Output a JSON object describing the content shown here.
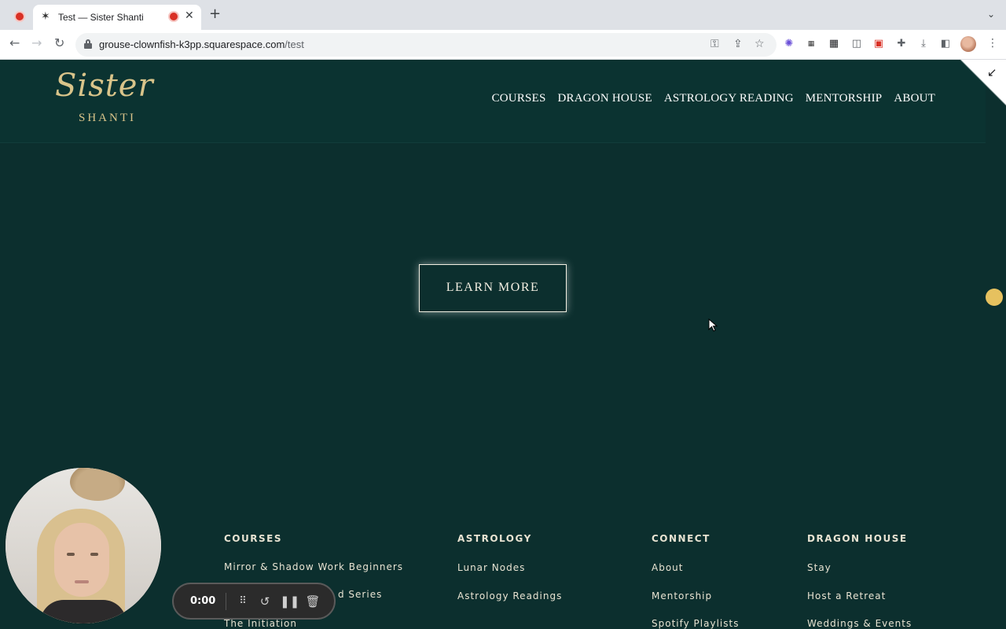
{
  "browser": {
    "tab_title": "Test — Sister Shanti",
    "url_host": "grouse-clownfish-k3pp.squarespace.com",
    "url_path": "/test"
  },
  "site": {
    "logo_script": "Sister",
    "logo_sub": "SHANTI",
    "nav": [
      "COURSES",
      "DRAGON HOUSE",
      "ASTROLOGY READING",
      "MENTORSHIP",
      "ABOUT"
    ],
    "cta_label": "LEARN MORE",
    "footer": {
      "courses": {
        "heading": "COURSES",
        "links": [
          "Mirror & Shadow Work Beginners",
          "d Series",
          "The Initiation"
        ]
      },
      "astrology": {
        "heading": "ASTROLOGY",
        "links": [
          "Lunar Nodes",
          "Astrology Readings"
        ]
      },
      "connect": {
        "heading": "CONNECT",
        "links": [
          "About",
          "Mentorship",
          "Spotify Playlists"
        ]
      },
      "dragon_house": {
        "heading": "DRAGON HOUSE",
        "links": [
          "Stay",
          "Host a Retreat",
          "Weddings & Events"
        ]
      }
    }
  },
  "recorder": {
    "time": "0:00"
  },
  "colors": {
    "page_bg": "#0c2f2e",
    "header_bg": "#0b3331",
    "logo_gold": "#d9c48a",
    "scroll_dot": "#e6c15f"
  }
}
